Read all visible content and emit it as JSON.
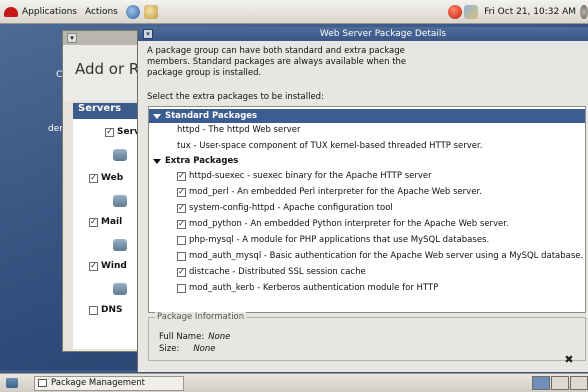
{
  "top_panel": {
    "menus": [
      "Applications",
      "Actions"
    ],
    "clock": "Fri Oct 21, 10:32 AM"
  },
  "desktop": {
    "label_co": "Co",
    "label_dem": "dem"
  },
  "bg_window": {
    "heading": "Add or R",
    "section": "Servers",
    "items": [
      {
        "label": "Serv",
        "checked": true
      },
      {
        "label": "Web",
        "checked": true
      },
      {
        "label": "Mail",
        "checked": true
      },
      {
        "label": "Wind",
        "checked": true
      },
      {
        "label": "DNS",
        "checked": false
      }
    ]
  },
  "dialog": {
    "title": "Web Server Package Details",
    "description": "A package group can have both standard and extra package members.  Standard packages are always available when the package group is installed.",
    "select_label": "Select the extra packages to be installed:",
    "standard_group": "Standard Packages",
    "standard_packages": [
      "httpd - The httpd Web server",
      "tux - User-space component of TUX kernel-based threaded HTTP server."
    ],
    "extra_group": "Extra Packages",
    "extra_packages": [
      {
        "label": "httpd-suexec - suexec binary for the Apache HTTP server",
        "checked": true
      },
      {
        "label": "mod_perl - An embedded Perl interpreter for the Apache Web server.",
        "checked": true
      },
      {
        "label": "system-config-httpd - Apache configuration tool",
        "checked": true
      },
      {
        "label": "mod_python - An embedded Python interpreter for the Apache Web server.",
        "checked": true
      },
      {
        "label": "php-mysql - A module for PHP applications that use MySQL databases.",
        "checked": false
      },
      {
        "label": "mod_auth_mysql - Basic authentication for the Apache Web server using a MySQL database.",
        "checked": false
      },
      {
        "label": "distcache - Distributed SSL session cache",
        "checked": true
      },
      {
        "label": "mod_auth_kerb - Kerberos authentication module for HTTP",
        "checked": false
      }
    ],
    "info": {
      "title": "Package Information",
      "full_name_label": "Full Name:",
      "full_name_value": "None",
      "size_label": "Size:",
      "size_value": "None"
    },
    "close_glyph": "✖"
  },
  "taskbar": {
    "task": "Package Management"
  }
}
